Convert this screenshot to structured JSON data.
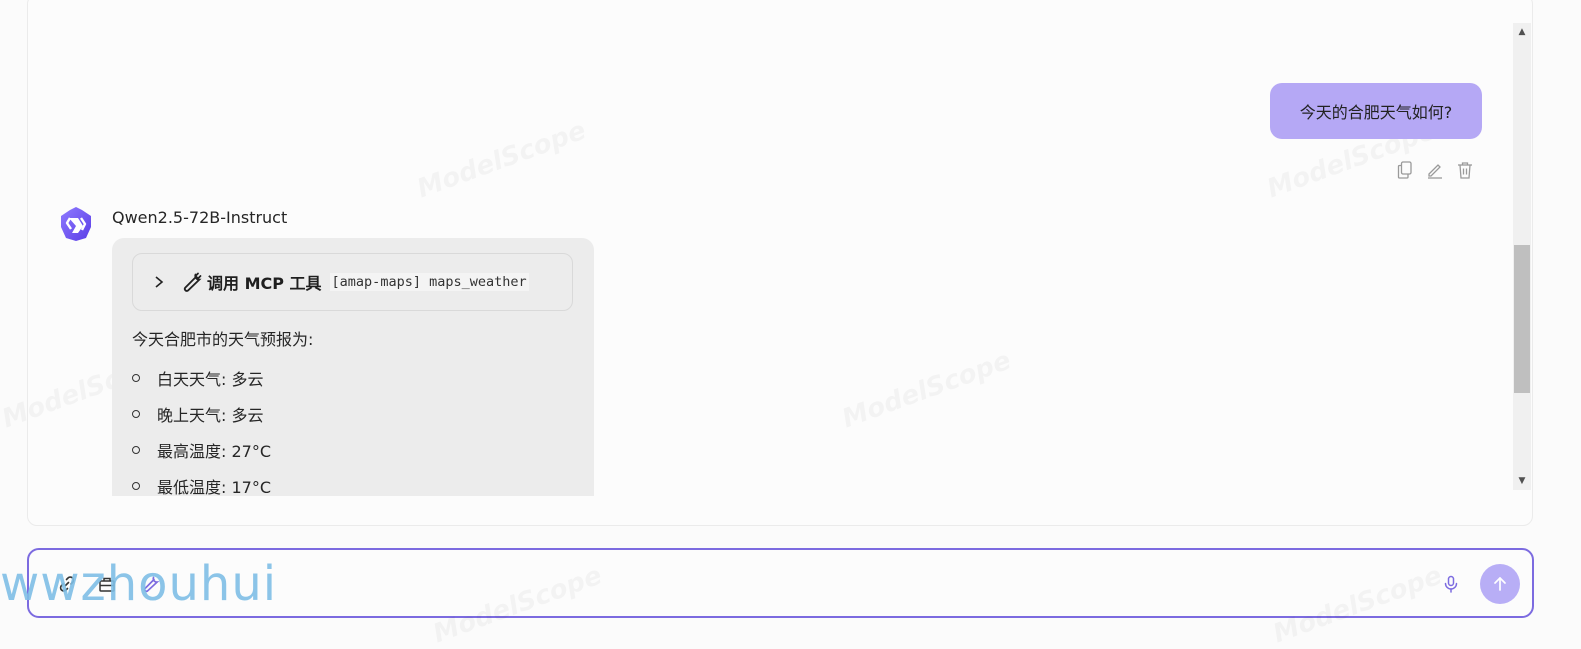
{
  "user_message": {
    "text": "今天的合肥天气如何?"
  },
  "message_actions": [
    "copy-icon",
    "edit-icon",
    "delete-icon"
  ],
  "bot": {
    "name": "Qwen2.5-72B-Instruct",
    "avatar_icon": "qwen-logo-icon",
    "tool_call": {
      "label": "调用 MCP 工具",
      "code": "[amap-maps] maps_weather"
    },
    "intro": "今天合肥市的天气预报为:",
    "items": [
      "白天天气: 多云",
      "晚上天气: 多云",
      "最高温度: 27°C",
      "最低温度: 17°C"
    ]
  },
  "input_bar": {
    "left_icons": [
      "link-icon",
      "toolbox-icon",
      "wrench-icon"
    ],
    "right_icons": [
      "microphone-icon",
      "send-arrow-icon"
    ]
  },
  "watermarks": {
    "background": "ModelScope",
    "overlay": "wwzhouhui"
  },
  "colors": {
    "user_bubble": "#b5a8f5",
    "bot_bubble": "#ececec",
    "accent": "#7c6be0",
    "send_button": "#b8aef6",
    "overlay_text": "#7fbfe6"
  }
}
